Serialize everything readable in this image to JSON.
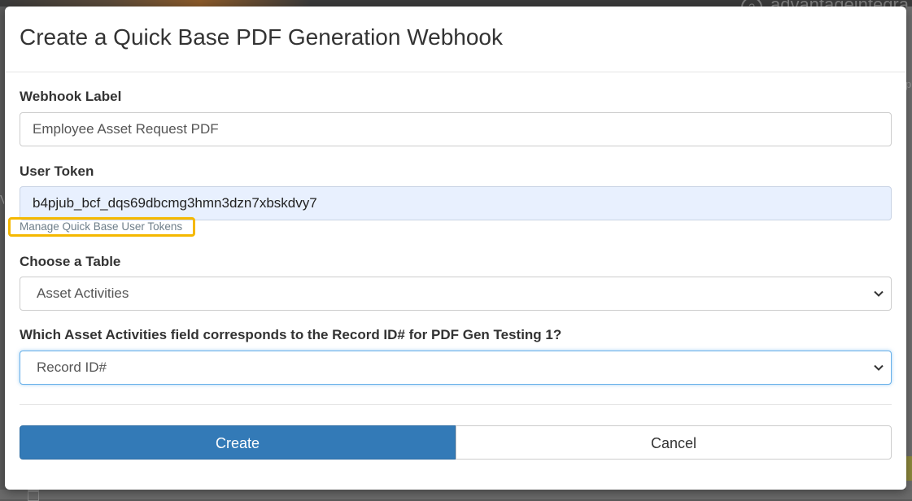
{
  "background": {
    "user_text": "advantageintegra",
    "help_icon_glyph": "?"
  },
  "modal": {
    "title": "Create a Quick Base PDF Generation Webhook",
    "webhook_label": {
      "label": "Webhook Label",
      "value": "Employee Asset Request PDF"
    },
    "user_token": {
      "label": "User Token",
      "value": "b4pjub_bcf_dqs69dbcmg3hmn3dzn7xbskdvy7",
      "manage_link": "Manage Quick Base User Tokens"
    },
    "table": {
      "label": "Choose a Table",
      "selected": "Asset Activities"
    },
    "record_field": {
      "label": "Which Asset Activities field corresponds to the Record ID# for PDF Gen Testing 1?",
      "selected": "Record ID#"
    },
    "buttons": {
      "create": "Create",
      "cancel": "Cancel"
    }
  },
  "colors": {
    "primary": "#337ab7",
    "highlight": "#f5b800",
    "autofill": "#e8f0fe",
    "focus": "#66afe9"
  },
  "icons": {
    "select_arrow": "chevron-down-icon",
    "help": "question-circle-icon",
    "calendar": "calendar-icon"
  }
}
